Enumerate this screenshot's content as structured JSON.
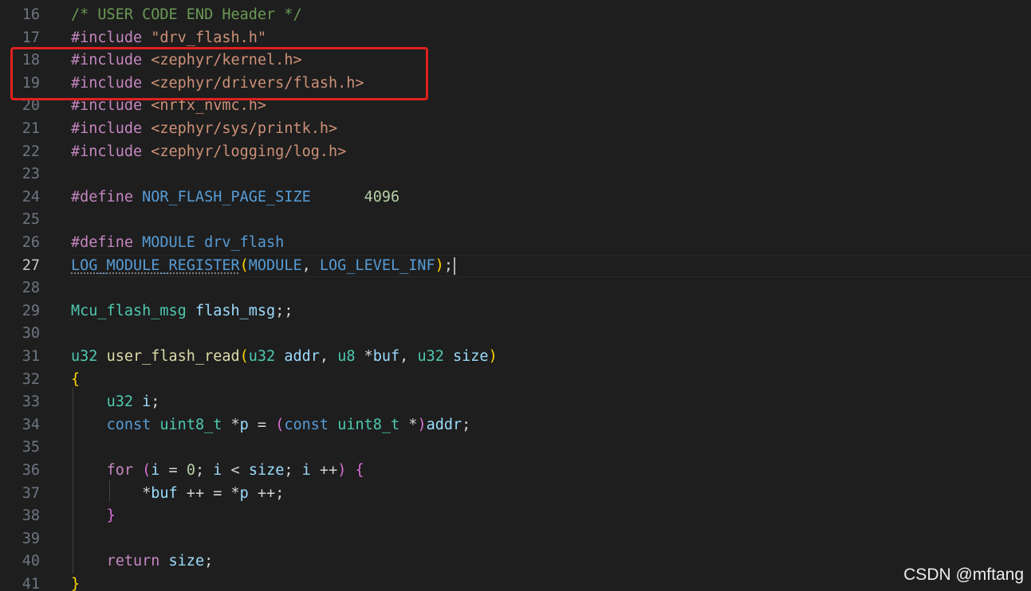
{
  "editor": {
    "current_line": 27,
    "lines": [
      {
        "n": "16",
        "tokens": [
          [
            "/* USER CODE END Header */",
            "comment"
          ]
        ]
      },
      {
        "n": "17",
        "tokens": [
          [
            "#include ",
            "directive"
          ],
          [
            "\"drv_flash.h\"",
            "string"
          ]
        ]
      },
      {
        "n": "18",
        "tokens": [
          [
            "#include ",
            "directive"
          ],
          [
            "<zephyr/kernel.h>",
            "string"
          ]
        ]
      },
      {
        "n": "19",
        "tokens": [
          [
            "#include ",
            "directive"
          ],
          [
            "<zephyr/drivers/flash.h>",
            "string"
          ]
        ]
      },
      {
        "n": "20",
        "tokens": [
          [
            "#include ",
            "directive"
          ],
          [
            "<nrfx_nvmc.h>",
            "string"
          ]
        ]
      },
      {
        "n": "21",
        "tokens": [
          [
            "#include ",
            "directive"
          ],
          [
            "<zephyr/sys/printk.h>",
            "string"
          ]
        ]
      },
      {
        "n": "22",
        "tokens": [
          [
            "#include ",
            "directive"
          ],
          [
            "<zephyr/logging/log.h>",
            "string"
          ]
        ]
      },
      {
        "n": "23",
        "tokens": []
      },
      {
        "n": "24",
        "tokens": [
          [
            "#define ",
            "directive"
          ],
          [
            "NOR_FLASH_PAGE_SIZE",
            "macro"
          ],
          [
            "      ",
            "plain"
          ],
          [
            "4096",
            "number"
          ]
        ]
      },
      {
        "n": "25",
        "tokens": []
      },
      {
        "n": "26",
        "tokens": [
          [
            "#define ",
            "directive"
          ],
          [
            "MODULE",
            "macro"
          ],
          [
            " ",
            "plain"
          ],
          [
            "drv_flash",
            "macro"
          ]
        ]
      },
      {
        "n": "27",
        "tokens": [
          [
            "LOG_MODULE_REGISTER",
            "macro squiggle"
          ],
          [
            "(",
            "brace1"
          ],
          [
            "MODULE",
            "macro"
          ],
          [
            ", ",
            "plain"
          ],
          [
            "LOG_LEVEL_INF",
            "macro"
          ],
          [
            ")",
            "brace1"
          ],
          [
            ";",
            "plain"
          ]
        ],
        "cursor": true
      },
      {
        "n": "28",
        "tokens": []
      },
      {
        "n": "29",
        "tokens": [
          [
            "Mcu_flash_msg",
            "type"
          ],
          [
            " ",
            "plain"
          ],
          [
            "flash_msg",
            "var"
          ],
          [
            ";;",
            "plain"
          ]
        ]
      },
      {
        "n": "30",
        "tokens": []
      },
      {
        "n": "31",
        "tokens": [
          [
            "u32",
            "type"
          ],
          [
            " ",
            "plain"
          ],
          [
            "user_flash_read",
            "func"
          ],
          [
            "(",
            "brace1"
          ],
          [
            "u32",
            "type"
          ],
          [
            " ",
            "plain"
          ],
          [
            "addr",
            "var"
          ],
          [
            ", ",
            "plain"
          ],
          [
            "u8",
            "type"
          ],
          [
            " *",
            "plain"
          ],
          [
            "buf",
            "var"
          ],
          [
            ", ",
            "plain"
          ],
          [
            "u32",
            "type"
          ],
          [
            " ",
            "plain"
          ],
          [
            "size",
            "var"
          ],
          [
            ")",
            "brace1"
          ]
        ]
      },
      {
        "n": "32",
        "tokens": [
          [
            "{",
            "brace1"
          ]
        ]
      },
      {
        "n": "33",
        "tokens": [
          [
            "    ",
            "plain"
          ],
          [
            "u32",
            "type"
          ],
          [
            " ",
            "plain"
          ],
          [
            "i",
            "var"
          ],
          [
            ";",
            "plain"
          ]
        ]
      },
      {
        "n": "34",
        "tokens": [
          [
            "    ",
            "plain"
          ],
          [
            "const",
            "keyword"
          ],
          [
            " ",
            "plain"
          ],
          [
            "uint8_t",
            "type"
          ],
          [
            " *",
            "plain"
          ],
          [
            "p",
            "var"
          ],
          [
            " = ",
            "plain"
          ],
          [
            "(",
            "brace2"
          ],
          [
            "const",
            "keyword"
          ],
          [
            " ",
            "plain"
          ],
          [
            "uint8_t",
            "type"
          ],
          [
            " *",
            "plain"
          ],
          [
            ")",
            "brace2"
          ],
          [
            "addr",
            "var"
          ],
          [
            ";",
            "plain"
          ]
        ]
      },
      {
        "n": "35",
        "tokens": []
      },
      {
        "n": "36",
        "tokens": [
          [
            "    ",
            "plain"
          ],
          [
            "for",
            "control"
          ],
          [
            " ",
            "plain"
          ],
          [
            "(",
            "brace2"
          ],
          [
            "i",
            "var"
          ],
          [
            " = ",
            "plain"
          ],
          [
            "0",
            "number"
          ],
          [
            "; ",
            "plain"
          ],
          [
            "i",
            "var"
          ],
          [
            " < ",
            "plain"
          ],
          [
            "size",
            "var"
          ],
          [
            "; ",
            "plain"
          ],
          [
            "i",
            "var"
          ],
          [
            " ++",
            "plain"
          ],
          [
            ")",
            "brace2"
          ],
          [
            " ",
            "plain"
          ],
          [
            "{",
            "brace2"
          ]
        ]
      },
      {
        "n": "37",
        "tokens": [
          [
            "        *",
            "plain"
          ],
          [
            "buf",
            "var"
          ],
          [
            " ++ = *",
            "plain"
          ],
          [
            "p",
            "var"
          ],
          [
            " ++;",
            "plain"
          ]
        ]
      },
      {
        "n": "38",
        "tokens": [
          [
            "    ",
            "plain"
          ],
          [
            "}",
            "brace2"
          ]
        ]
      },
      {
        "n": "39",
        "tokens": []
      },
      {
        "n": "40",
        "tokens": [
          [
            "    ",
            "plain"
          ],
          [
            "return",
            "control"
          ],
          [
            " ",
            "plain"
          ],
          [
            "size",
            "var"
          ],
          [
            ";",
            "plain"
          ]
        ]
      },
      {
        "n": "41",
        "tokens": [
          [
            "}",
            "brace1"
          ]
        ]
      }
    ]
  },
  "annotation": {
    "label": "highlighted-includes",
    "lines": [
      "18",
      "19"
    ],
    "color": "#e02020"
  },
  "watermark": {
    "text": "CSDN @mftang"
  },
  "colors": {
    "background": "#1e1e1e",
    "comment": "#6a9955",
    "directive": "#c586c0",
    "string": "#ce9178",
    "macro": "#569cd6",
    "number": "#b5cea8",
    "type": "#4ec9b0",
    "variable": "#9cdcfe",
    "function": "#dcdcaa"
  }
}
